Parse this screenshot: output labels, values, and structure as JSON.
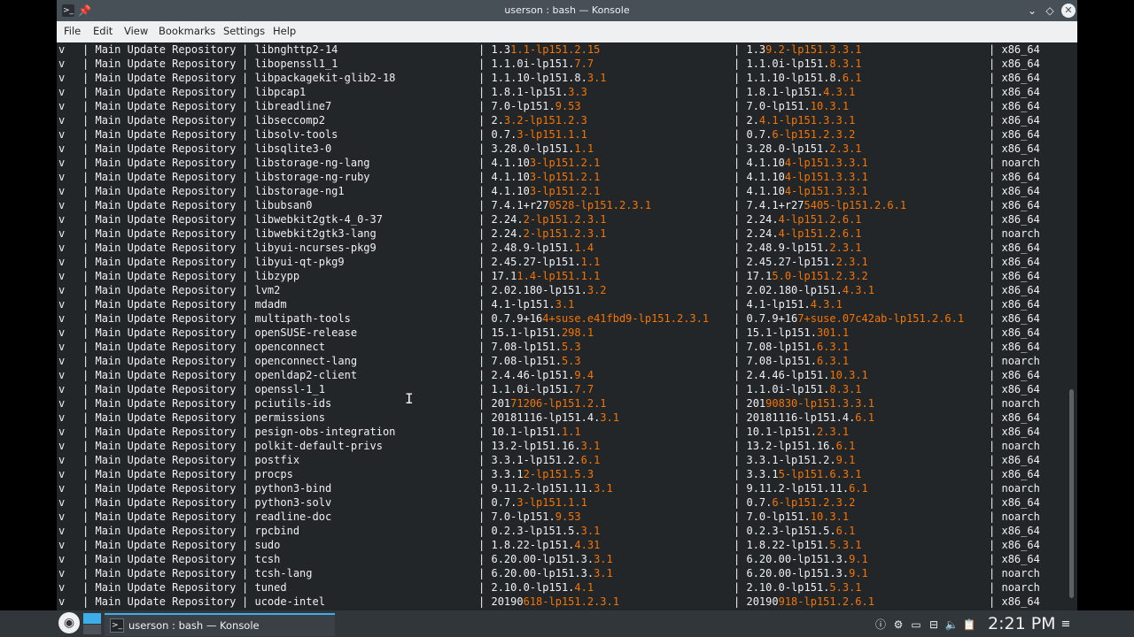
{
  "window": {
    "title": "userson : bash — Konsole",
    "app_icon": "terminal-icon",
    "app_icon_glyph": ">_",
    "pin_glyph": "📌",
    "min_glyph": "⌄",
    "max_glyph": "◇",
    "close_glyph": "✕"
  },
  "menubar": {
    "items": [
      {
        "label": "File"
      },
      {
        "label": "Edit"
      },
      {
        "label": "View"
      },
      {
        "label": "Bookmarks"
      },
      {
        "label": "Settings"
      },
      {
        "label": "Help"
      }
    ]
  },
  "terminal": {
    "separator": "|",
    "highlight_color": "#f67400",
    "rows": [
      {
        "status": "v",
        "repo": "Main Update Repository",
        "name": "libnghttp2-14",
        "cur_pre": "1.3",
        "cur_hl": "1.1-lp151.2.15",
        "avail_pre": "1.3",
        "avail_hl": "9.2-lp151.3.3.1",
        "arch": "x86_64"
      },
      {
        "status": "v",
        "repo": "Main Update Repository",
        "name": "libopenssl1_1",
        "cur_pre": "1.1.0i-lp151.",
        "cur_hl": "7.7",
        "avail_pre": "1.1.0i-lp151.",
        "avail_hl": "8.3.1",
        "arch": "x86_64"
      },
      {
        "status": "v",
        "repo": "Main Update Repository",
        "name": "libpackagekit-glib2-18",
        "cur_pre": "1.1.10-lp151.8.",
        "cur_hl": "3.1",
        "avail_pre": "1.1.10-lp151.8.",
        "avail_hl": "6.1",
        "arch": "x86_64"
      },
      {
        "status": "v",
        "repo": "Main Update Repository",
        "name": "libpcap1",
        "cur_pre": "1.8.1-lp151.",
        "cur_hl": "3.3",
        "avail_pre": "1.8.1-lp151.",
        "avail_hl": "4.3.1",
        "arch": "x86_64"
      },
      {
        "status": "v",
        "repo": "Main Update Repository",
        "name": "libreadline7",
        "cur_pre": "7.0-lp151.",
        "cur_hl": "9.53",
        "avail_pre": "7.0-lp151.",
        "avail_hl": "10.3.1",
        "arch": "x86_64"
      },
      {
        "status": "v",
        "repo": "Main Update Repository",
        "name": "libseccomp2",
        "cur_pre": "2.",
        "cur_hl": "3.2-lp151.2.3",
        "avail_pre": "2.",
        "avail_hl": "4.1-lp151.3.3.1",
        "arch": "x86_64"
      },
      {
        "status": "v",
        "repo": "Main Update Repository",
        "name": "libsolv-tools",
        "cur_pre": "0.7.",
        "cur_hl": "3-lp151.1.1",
        "avail_pre": "0.7.",
        "avail_hl": "6-lp151.2.3.2",
        "arch": "x86_64"
      },
      {
        "status": "v",
        "repo": "Main Update Repository",
        "name": "libsqlite3-0",
        "cur_pre": "3.28.0-lp151.",
        "cur_hl": "1.1",
        "avail_pre": "3.28.0-lp151.",
        "avail_hl": "2.3.1",
        "arch": "x86_64"
      },
      {
        "status": "v",
        "repo": "Main Update Repository",
        "name": "libstorage-ng-lang",
        "cur_pre": "4.1.10",
        "cur_hl": "3-lp151.2.1",
        "avail_pre": "4.1.10",
        "avail_hl": "4-lp151.3.3.1",
        "arch": "noarch"
      },
      {
        "status": "v",
        "repo": "Main Update Repository",
        "name": "libstorage-ng-ruby",
        "cur_pre": "4.1.10",
        "cur_hl": "3-lp151.2.1",
        "avail_pre": "4.1.10",
        "avail_hl": "4-lp151.3.3.1",
        "arch": "x86_64"
      },
      {
        "status": "v",
        "repo": "Main Update Repository",
        "name": "libstorage-ng1",
        "cur_pre": "4.1.10",
        "cur_hl": "3-lp151.2.1",
        "avail_pre": "4.1.10",
        "avail_hl": "4-lp151.3.3.1",
        "arch": "x86_64"
      },
      {
        "status": "v",
        "repo": "Main Update Repository",
        "name": "libubsan0",
        "cur_pre": "7.4.1+r27",
        "cur_hl": "0528-lp151.2.3.1",
        "avail_pre": "7.4.1+r27",
        "avail_hl": "5405-lp151.2.6.1",
        "arch": "x86_64"
      },
      {
        "status": "v",
        "repo": "Main Update Repository",
        "name": "libwebkit2gtk-4_0-37",
        "cur_pre": "2.24.",
        "cur_hl": "2-lp151.2.3.1",
        "avail_pre": "2.24.",
        "avail_hl": "4-lp151.2.6.1",
        "arch": "x86_64"
      },
      {
        "status": "v",
        "repo": "Main Update Repository",
        "name": "libwebkit2gtk3-lang",
        "cur_pre": "2.24.",
        "cur_hl": "2-lp151.2.3.1",
        "avail_pre": "2.24.",
        "avail_hl": "4-lp151.2.6.1",
        "arch": "noarch"
      },
      {
        "status": "v",
        "repo": "Main Update Repository",
        "name": "libyui-ncurses-pkg9",
        "cur_pre": "2.48.9-lp151.",
        "cur_hl": "1.4",
        "avail_pre": "2.48.9-lp151.",
        "avail_hl": "2.3.1",
        "arch": "x86_64"
      },
      {
        "status": "v",
        "repo": "Main Update Repository",
        "name": "libyui-qt-pkg9",
        "cur_pre": "2.45.27-lp151.",
        "cur_hl": "1.1",
        "avail_pre": "2.45.27-lp151.",
        "avail_hl": "2.3.1",
        "arch": "x86_64"
      },
      {
        "status": "v",
        "repo": "Main Update Repository",
        "name": "libzypp",
        "cur_pre": "17.1",
        "cur_hl": "1.4-lp151.1.1",
        "avail_pre": "17.1",
        "avail_hl": "5.0-lp151.2.3.2",
        "arch": "x86_64"
      },
      {
        "status": "v",
        "repo": "Main Update Repository",
        "name": "lvm2",
        "cur_pre": "2.02.180-lp151.",
        "cur_hl": "3.2",
        "avail_pre": "2.02.180-lp151.",
        "avail_hl": "4.3.1",
        "arch": "x86_64"
      },
      {
        "status": "v",
        "repo": "Main Update Repository",
        "name": "mdadm",
        "cur_pre": "4.1-lp151.",
        "cur_hl": "3.1",
        "avail_pre": "4.1-lp151.",
        "avail_hl": "4.3.1",
        "arch": "x86_64"
      },
      {
        "status": "v",
        "repo": "Main Update Repository",
        "name": "multipath-tools",
        "cur_pre": "0.7.9+16",
        "cur_hl": "4+suse.e41fbd9-lp151.2.3.1",
        "avail_pre": "0.7.9+16",
        "avail_hl": "7+suse.07c42ab-lp151.2.6.1",
        "arch": "x86_64"
      },
      {
        "status": "v",
        "repo": "Main Update Repository",
        "name": "openSUSE-release",
        "cur_pre": "15.1-lp151.",
        "cur_hl": "298.1",
        "avail_pre": "15.1-lp151.",
        "avail_hl": "301.1",
        "arch": "x86_64"
      },
      {
        "status": "v",
        "repo": "Main Update Repository",
        "name": "openconnect",
        "cur_pre": "7.08-lp151.",
        "cur_hl": "5.3",
        "avail_pre": "7.08-lp151.",
        "avail_hl": "6.3.1",
        "arch": "x86_64"
      },
      {
        "status": "v",
        "repo": "Main Update Repository",
        "name": "openconnect-lang",
        "cur_pre": "7.08-lp151.",
        "cur_hl": "5.3",
        "avail_pre": "7.08-lp151.",
        "avail_hl": "6.3.1",
        "arch": "noarch"
      },
      {
        "status": "v",
        "repo": "Main Update Repository",
        "name": "openldap2-client",
        "cur_pre": "2.4.46-lp151.",
        "cur_hl": "9.4",
        "avail_pre": "2.4.46-lp151.",
        "avail_hl": "10.3.1",
        "arch": "x86_64"
      },
      {
        "status": "v",
        "repo": "Main Update Repository",
        "name": "openssl-1_1",
        "cur_pre": "1.1.0i-lp151.",
        "cur_hl": "7.7",
        "avail_pre": "1.1.0i-lp151.",
        "avail_hl": "8.3.1",
        "arch": "x86_64"
      },
      {
        "status": "v",
        "repo": "Main Update Repository",
        "name": "pciutils-ids",
        "cur_pre": "201",
        "cur_hl": "71206-lp151.2.1",
        "avail_pre": "201",
        "avail_hl": "90830-lp151.3.3.1",
        "arch": "noarch"
      },
      {
        "status": "v",
        "repo": "Main Update Repository",
        "name": "permissions",
        "cur_pre": "20181116-lp151.4.",
        "cur_hl": "3.1",
        "avail_pre": "20181116-lp151.4.",
        "avail_hl": "6.1",
        "arch": "x86_64"
      },
      {
        "status": "v",
        "repo": "Main Update Repository",
        "name": "pesign-obs-integration",
        "cur_pre": "10.1-lp151.",
        "cur_hl": "1.1",
        "avail_pre": "10.1-lp151.",
        "avail_hl": "2.3.1",
        "arch": "x86_64"
      },
      {
        "status": "v",
        "repo": "Main Update Repository",
        "name": "polkit-default-privs",
        "cur_pre": "13.2-lp151.16.",
        "cur_hl": "3.1",
        "avail_pre": "13.2-lp151.16.",
        "avail_hl": "6.1",
        "arch": "noarch"
      },
      {
        "status": "v",
        "repo": "Main Update Repository",
        "name": "postfix",
        "cur_pre": "3.3.1-lp151.2.",
        "cur_hl": "6.1",
        "avail_pre": "3.3.1-lp151.2.",
        "avail_hl": "9.1",
        "arch": "x86_64"
      },
      {
        "status": "v",
        "repo": "Main Update Repository",
        "name": "procps",
        "cur_pre": "3.3.1",
        "cur_hl": "2-lp151.5.3",
        "avail_pre": "3.3.1",
        "avail_hl": "5-lp151.6.3.1",
        "arch": "x86_64"
      },
      {
        "status": "v",
        "repo": "Main Update Repository",
        "name": "python3-bind",
        "cur_pre": "9.11.2-lp151.11.",
        "cur_hl": "3.1",
        "avail_pre": "9.11.2-lp151.11.",
        "avail_hl": "6.1",
        "arch": "noarch"
      },
      {
        "status": "v",
        "repo": "Main Update Repository",
        "name": "python3-solv",
        "cur_pre": "0.7.",
        "cur_hl": "3-lp151.1.1",
        "avail_pre": "0.7.",
        "avail_hl": "6-lp151.2.3.2",
        "arch": "x86_64"
      },
      {
        "status": "v",
        "repo": "Main Update Repository",
        "name": "readline-doc",
        "cur_pre": "7.0-lp151.",
        "cur_hl": "9.53",
        "avail_pre": "7.0-lp151.",
        "avail_hl": "10.3.1",
        "arch": "noarch"
      },
      {
        "status": "v",
        "repo": "Main Update Repository",
        "name": "rpcbind",
        "cur_pre": "0.2.3-lp151.5.",
        "cur_hl": "3.1",
        "avail_pre": "0.2.3-lp151.5.",
        "avail_hl": "6.1",
        "arch": "x86_64"
      },
      {
        "status": "v",
        "repo": "Main Update Repository",
        "name": "sudo",
        "cur_pre": "1.8.22-lp151.",
        "cur_hl": "4.31",
        "avail_pre": "1.8.22-lp151.",
        "avail_hl": "5.3.1",
        "arch": "x86_64"
      },
      {
        "status": "v",
        "repo": "Main Update Repository",
        "name": "tcsh",
        "cur_pre": "6.20.00-lp151.3.",
        "cur_hl": "3.1",
        "avail_pre": "6.20.00-lp151.3.",
        "avail_hl": "9.1",
        "arch": "x86_64"
      },
      {
        "status": "v",
        "repo": "Main Update Repository",
        "name": "tcsh-lang",
        "cur_pre": "6.20.00-lp151.3.",
        "cur_hl": "3.1",
        "avail_pre": "6.20.00-lp151.3.",
        "avail_hl": "9.1",
        "arch": "noarch"
      },
      {
        "status": "v",
        "repo": "Main Update Repository",
        "name": "tuned",
        "cur_pre": "2.10.0-lp151.",
        "cur_hl": "4.1",
        "avail_pre": "2.10.0-lp151.",
        "avail_hl": "5.3.1",
        "arch": "noarch"
      },
      {
        "status": "v",
        "repo": "Main Update Repository",
        "name": "ucode-intel",
        "cur_pre": "20190",
        "cur_hl": "618-lp151.2.3.1",
        "avail_pre": "20190",
        "avail_hl": "918-lp151.2.6.1",
        "arch": "x86_64"
      }
    ]
  },
  "mouse_cursor_glyph": "I",
  "taskbar": {
    "launcher_icon": "opensuse-launcher-icon",
    "launcher_glyph": "◉",
    "task": {
      "label": "userson : bash — Konsole",
      "icon": "terminal-icon",
      "icon_glyph": ">_"
    },
    "tray": [
      {
        "name": "notifications-icon",
        "glyph": "ⓘ"
      },
      {
        "name": "updates-icon",
        "glyph": "⚙"
      },
      {
        "name": "display-icon",
        "glyph": "▭"
      },
      {
        "name": "network-icon",
        "glyph": "⊟"
      },
      {
        "name": "volume-icon",
        "glyph": "🔈"
      },
      {
        "name": "clipboard-icon",
        "glyph": "📋"
      },
      {
        "name": "expand-tray-icon",
        "glyph": "⌃"
      }
    ],
    "clock": "2:21 PM",
    "menu_glyph": "≡"
  },
  "colors": {
    "terminal_bg": "#232629",
    "terminal_fg": "#eff0f1",
    "highlight": "#f67400",
    "titlebar": "#475057",
    "menubar": "#eff0f1",
    "panel": "#31363b",
    "accent": "#3daee9"
  }
}
